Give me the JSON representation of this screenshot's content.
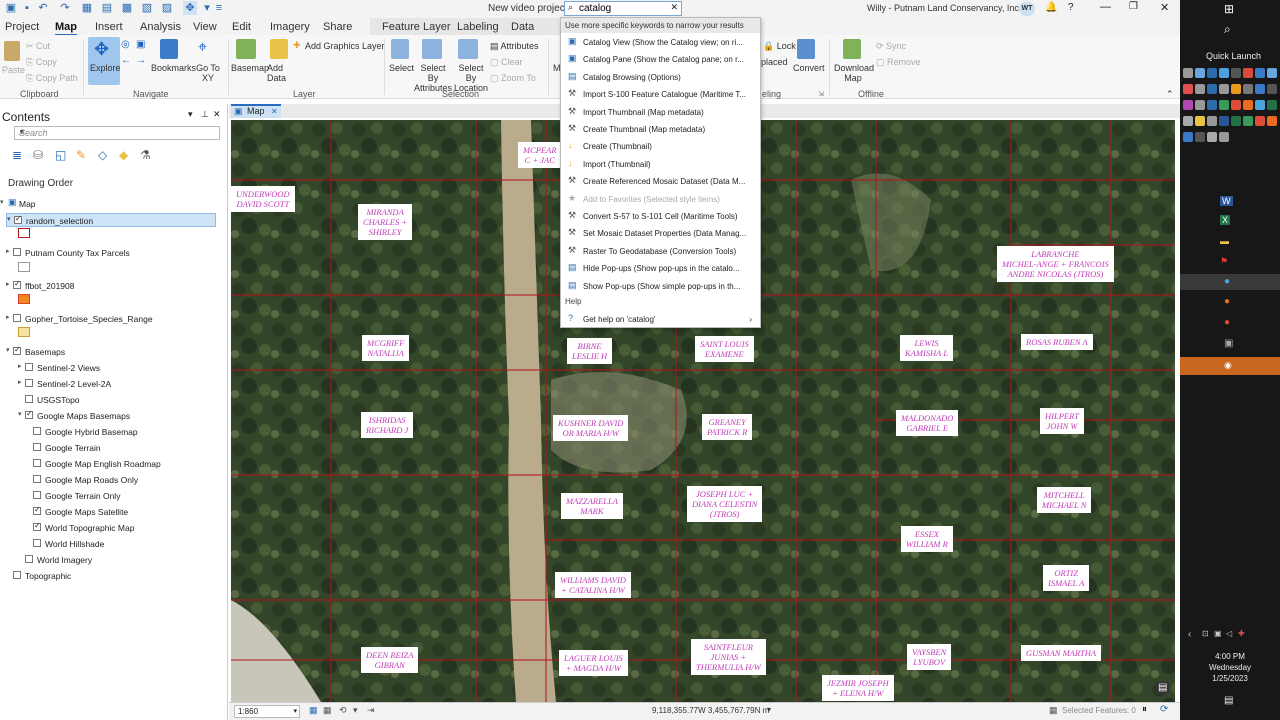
{
  "titlebar": {
    "project": "New video project",
    "user": "Willy - Putnam Land Conservancy, Inc.",
    "avatar": "WT"
  },
  "search": {
    "value": "catalog"
  },
  "tabs": [
    "Project",
    "Map",
    "Insert",
    "Analysis",
    "View",
    "Edit",
    "Imagery",
    "Share"
  ],
  "context_tabs": [
    "Feature Layer",
    "Labeling",
    "Data"
  ],
  "ribbon": {
    "clipboard": {
      "label": "Clipboard",
      "paste": "Paste",
      "cut": "Cut",
      "copy": "Copy",
      "copy_path": "Copy Path"
    },
    "navigate": {
      "label": "Navigate",
      "explore": "Explore",
      "bookmarks": "Bookmarks",
      "go_to_xy": "Go To XY"
    },
    "layer": {
      "label": "Layer",
      "basemap": "Basemap",
      "add_data": "Add Data",
      "add_graphics": "Add Graphics Layer"
    },
    "selection": {
      "label": "Selection",
      "select": "Select",
      "select_attr": "Select By Attributes",
      "select_loc": "Select By Location",
      "attributes": "Attributes",
      "clear": "Clear",
      "zoom_to": "Zoom To"
    },
    "offline": {
      "label": "Offline",
      "download": "Download Map",
      "sync": "Sync",
      "remove": "Remove"
    },
    "lock": "Lock",
    "placed": "placed",
    "convert": "Convert",
    "eling": "eling"
  },
  "contents": {
    "title": "Contents",
    "search_placeholder": "Search",
    "drawing_order": "Drawing Order",
    "layers": [
      "Map",
      "random_selection",
      "Putnam County Tax Parcels",
      "ffbot_201908",
      "Gopher_Tortoise_Species_Range",
      "Basemaps",
      "Sentinel-2 Views",
      "Sentinel-2 Level-2A",
      "USGSTopo",
      "Google Maps Basemaps",
      "Google Hybrid Basemap",
      "Google Terrain",
      "Google Map English Roadmap",
      "Google Map Roads Only",
      "Google Terrain Only",
      "Google Maps Satellite",
      "World Topographic Map",
      "World Hillshade",
      "World Imagery",
      "Topographic"
    ]
  },
  "map": {
    "tab": "Map",
    "parcels": [
      "UNDERWOOD\nDAVID SCOTT",
      "MCPEAR\nC + JAC",
      "MIRANDA\nCHARLES +\nSHIRLEY",
      "LABRANCHE\nMICHEL-ANGE + FRANCOIS\nANDRE NICOLAS (JTROS)",
      "MCGRIFF\nNATALIJA",
      "BIRNE\nLESLIE H",
      "SAINT LOUIS\nEXAMENE",
      "LEWIS\nKAMISHA L",
      "ROSAS RUBEN A",
      "ISHRIDAS\nRICHARD J",
      "KUSHNER DAVID\nOR MARIA H/W",
      "GREANEY\nPATRICK R",
      "MALDONADO\nGABRIEL E",
      "HILPERT\nJOHN W",
      "MAZZARELLA\nMARK",
      "JOSEPH LUC +\nDIANA CELESTIN\n(JTROS)",
      "MITCHELL\nMICHAEL N",
      "ESSEX\nWILLIAM R",
      "WILLIAMS DAVID\n+ CATALINA H/W",
      "ORTIZ\nISMAEL A",
      "DEEN REIZA\nGIBRAN",
      "LAGUER LOUIS\n+ MAGDA H/W",
      "SAINTFLEUR\nJUNIAS +\nTHERMULIA H/W",
      "VAYSBEN\nLYUBOV",
      "GUSMAN MARTHA",
      "JEZMIR JOSEPH\n+ ELENA H/W"
    ]
  },
  "status": {
    "scale": "1:860",
    "coords": "9,118,355.77W 3,455,767.79N m",
    "selected": "Selected Features: 0"
  },
  "dropdown": {
    "hint": "Use more specific keywords to narrow your results",
    "items": [
      "Catalog View (Show the Catalog view; on ri...",
      "Catalog Pane (Show the Catalog pane; on r...",
      "Catalog Browsing (Options)",
      "Import S-100 Feature Catalogue (Maritime T...",
      "Import Thumbnail (Map metadata)",
      "Create Thumbnail (Map metadata)",
      "Create (Thumbnail)",
      "Import (Thumbnail)",
      "Create Referenced Mosaic Dataset (Data M...",
      "Add to Favorites (Selected style items)",
      "Convert S-57 to S-101 Cell (Maritime Tools)",
      "Set Mosaic Dataset Properties (Data Manag...",
      "Raster To Geodatabase (Conversion Tools)",
      "Hide Pop-ups (Show pop-ups in the catalo...",
      "Show Pop-ups (Show simple pop-ups in th..."
    ],
    "help_header": "Help",
    "help_item": "Get help on  'catalog'"
  },
  "taskbar": {
    "quick_launch": "Quick Launch",
    "time": "4:00 PM",
    "day": "Wednesday",
    "date": "1/25/2023"
  }
}
